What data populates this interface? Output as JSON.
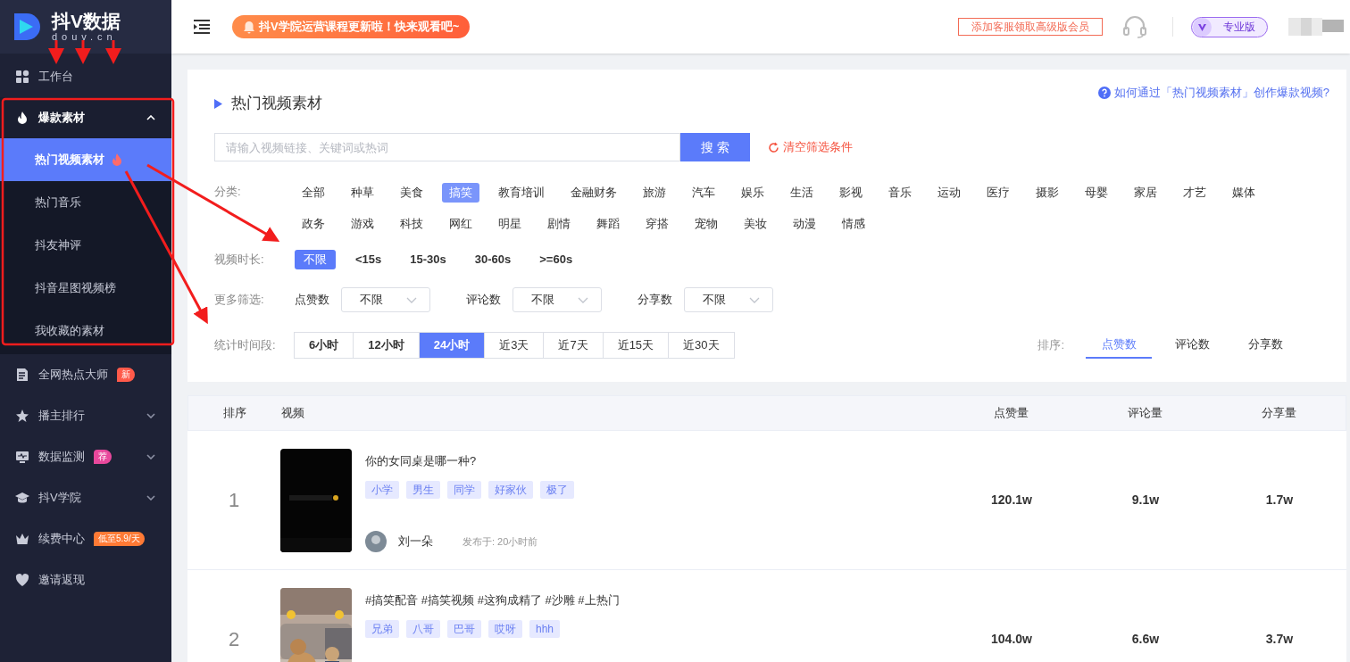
{
  "sidebar": {
    "logo_title": "抖V数据",
    "logo_subtitle": "douv.cn",
    "items": [
      {
        "label": "工作台",
        "expandable": false
      },
      {
        "label": "爆款素材",
        "expandable": true,
        "expanded": true,
        "children": [
          {
            "label": "热门视频素材",
            "selected": true,
            "hot": true
          },
          {
            "label": "热门音乐",
            "selected": false,
            "hot": false
          },
          {
            "label": "抖友神评",
            "selected": false,
            "hot": false
          },
          {
            "label": "抖音星图视频榜",
            "selected": false,
            "hot": false
          },
          {
            "label": "我收藏的素材",
            "selected": false,
            "hot": false
          }
        ]
      },
      {
        "label": "全网热点大师",
        "expandable": false,
        "badge": {
          "text": "新",
          "color": "#ff5a4a"
        }
      },
      {
        "label": "播主排行",
        "expandable": true,
        "expanded": false
      },
      {
        "label": "数据监测",
        "expandable": true,
        "expanded": false,
        "badge": {
          "text": "荐",
          "color": "#e8489c"
        }
      },
      {
        "label": "抖V学院",
        "expandable": true,
        "expanded": false
      },
      {
        "label": "续费中心",
        "expandable": false,
        "badge": {
          "text": "低至5.9/天",
          "color": "#ff7a35"
        }
      },
      {
        "label": "邀请返现",
        "expandable": false
      }
    ]
  },
  "header": {
    "notice": "抖V学院运营课程更新啦！快来观看吧~",
    "promo": "添加客服领取高级版会员",
    "plan": "专业版"
  },
  "page": {
    "title": "热门视频素材",
    "help_link": "如何通过「热门视频素材」创作爆款视频?",
    "search": {
      "placeholder": "请输入视频链接、关键词或热词",
      "button": "搜 索"
    },
    "clear": "清空筛选条件",
    "category": {
      "label": "分类:",
      "options": [
        {
          "label": "全部",
          "selected": false
        },
        {
          "label": "种草",
          "selected": false
        },
        {
          "label": "美食",
          "selected": false
        },
        {
          "label": "搞笑",
          "selected": true
        },
        {
          "label": "教育培训",
          "selected": false
        },
        {
          "label": "金融财务",
          "selected": false
        },
        {
          "label": "旅游",
          "selected": false
        },
        {
          "label": "汽车",
          "selected": false
        },
        {
          "label": "娱乐",
          "selected": false
        },
        {
          "label": "生活",
          "selected": false
        },
        {
          "label": "影视",
          "selected": false
        },
        {
          "label": "音乐",
          "selected": false
        },
        {
          "label": "运动",
          "selected": false
        },
        {
          "label": "医疗",
          "selected": false
        },
        {
          "label": "摄影",
          "selected": false
        },
        {
          "label": "母婴",
          "selected": false
        },
        {
          "label": "家居",
          "selected": false
        },
        {
          "label": "才艺",
          "selected": false
        },
        {
          "label": "媒体",
          "selected": false
        },
        {
          "label": "政务",
          "selected": false
        },
        {
          "label": "游戏",
          "selected": false
        },
        {
          "label": "科技",
          "selected": false
        },
        {
          "label": "网红",
          "selected": false
        },
        {
          "label": "明星",
          "selected": false
        },
        {
          "label": "剧情",
          "selected": false
        },
        {
          "label": "舞蹈",
          "selected": false
        },
        {
          "label": "穿搭",
          "selected": false
        },
        {
          "label": "宠物",
          "selected": false
        },
        {
          "label": "美妆",
          "selected": false
        },
        {
          "label": "动漫",
          "selected": false
        },
        {
          "label": "情感",
          "selected": false
        }
      ]
    },
    "duration": {
      "label": "视频时长:",
      "options": [
        {
          "label": "不限",
          "selected": true
        },
        {
          "label": "<15s",
          "selected": false
        },
        {
          "label": "15-30s",
          "selected": false
        },
        {
          "label": "30-60s",
          "selected": false
        },
        {
          "label": ">=60s",
          "selected": false
        }
      ]
    },
    "more": {
      "label": "更多筛选:",
      "selects": [
        {
          "label": "点赞数",
          "value": "不限"
        },
        {
          "label": "评论数",
          "value": "不限"
        },
        {
          "label": "分享数",
          "value": "不限"
        }
      ]
    },
    "period": {
      "label": "统计时间段:",
      "options": [
        {
          "label": "6小时",
          "selected": false
        },
        {
          "label": "12小时",
          "selected": false
        },
        {
          "label": "24小时",
          "selected": true
        },
        {
          "label": "近3天",
          "selected": false
        },
        {
          "label": "近7天",
          "selected": false
        },
        {
          "label": "近15天",
          "selected": false
        },
        {
          "label": "近30天",
          "selected": false
        }
      ]
    },
    "sort": {
      "label": "排序:",
      "options": [
        {
          "label": "点赞数",
          "selected": true
        },
        {
          "label": "评论数",
          "selected": false
        },
        {
          "label": "分享数",
          "selected": false
        }
      ]
    }
  },
  "table": {
    "columns": [
      "排序",
      "视频",
      "点赞量",
      "评论量",
      "分享量"
    ],
    "rows": [
      {
        "rank": "1",
        "title": "你的女同桌是哪一种?",
        "tags": [
          "小学",
          "男生",
          "同学",
          "好家伙",
          "极了"
        ],
        "author": "刘一朵",
        "published": "发布于: 20小时前",
        "likes": "120.1w",
        "comments": "9.1w",
        "shares": "1.7w"
      },
      {
        "rank": "2",
        "title": "#搞笑配音 #搞笑视频 #这狗成精了 #沙雕 #上热门",
        "tags": [
          "兄弟",
          "八哥",
          "巴哥",
          "哎呀",
          "hhh"
        ],
        "likes": "104.0w",
        "comments": "6.6w",
        "shares": "3.7w"
      }
    ]
  }
}
